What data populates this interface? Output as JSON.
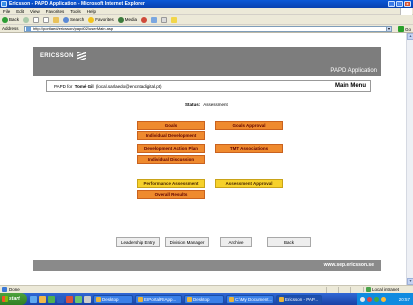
{
  "window": {
    "title": "Ericsson - PAPD Application - Microsoft Internet Explorer",
    "controls": [
      "_",
      "□",
      "x"
    ]
  },
  "menu": [
    "File",
    "Edit",
    "View",
    "Favorites",
    "Tools",
    "Help"
  ],
  "toolbar": {
    "back": "Back",
    "search": "Search",
    "favorites": "Favorites",
    "media": "Media"
  },
  "address": {
    "label": "Address",
    "url": "http://portlaed/ericsson/papd02/userMain.asp",
    "go": "Go"
  },
  "header": {
    "brand": "ERICSSON",
    "app_title": "PAPD Application"
  },
  "user_row": {
    "prefix": "PAPD for",
    "user_name": "Tomé Gil",
    "email": "(local.sarlaedo@encntadigital.pt)",
    "main_menu": "Main Menu"
  },
  "status": {
    "label": "Status:",
    "value": "Assessment"
  },
  "menu_buttons": {
    "goals": "Goals",
    "goals_approval": "Goals Approval",
    "individual_development": "Individual Development",
    "development_action_plan": "Development Action Plan",
    "tmt_associations": "TMT Associations",
    "individual_discussion": "Individual Discussion",
    "performance_assessment": "Performance Assessment",
    "assessment_approval": "Assessment Approval",
    "overall_results": "Overall Results"
  },
  "nav_buttons": {
    "leadership_entry": "Leadership Entry",
    "division_manager": "Division Manager",
    "archive": "Archive",
    "back": "Back"
  },
  "footer": {
    "url": "www.sep.ericsson.se"
  },
  "statusbar": {
    "left": "Done",
    "zone": "Local intranet"
  },
  "taskbar": {
    "start": "start",
    "tasks": [
      "Desktop",
      "EIPortalRIApp...",
      "Desktop",
      "C:\\My Document...",
      "Ericsson - PAP..."
    ],
    "clock": "20:57"
  },
  "colors": {
    "orange_button": "#ef8a2e",
    "yellow_button": "#f6d12b",
    "band_gray": "#7d7d7d"
  }
}
